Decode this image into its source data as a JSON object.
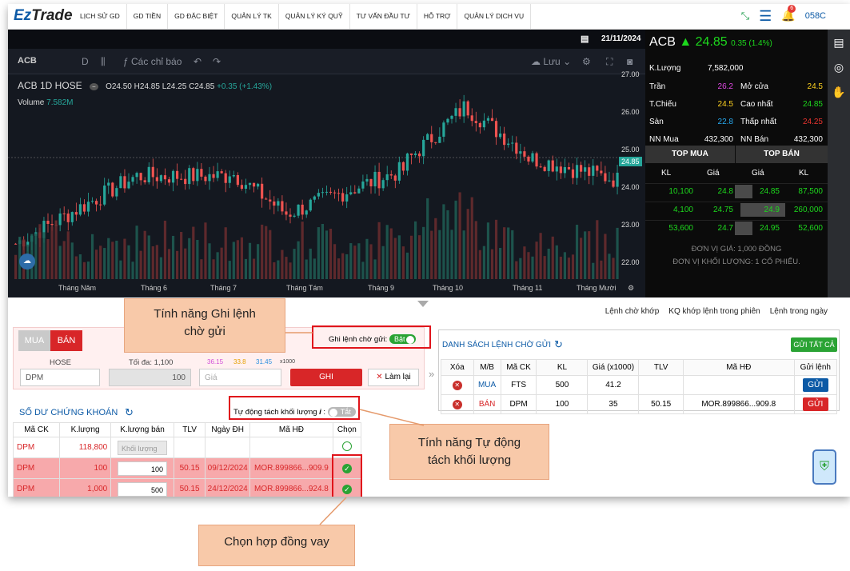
{
  "nav": {
    "logo_ez": "Ez",
    "logo_trade": "Trade",
    "menu": [
      "LỊCH SỬ GD",
      "GD TIỀN",
      "GD ĐẶC BIỆT",
      "QUẢN LÝ TK",
      "QUẢN LÝ KÝ QUỸ",
      "TƯ VẤN ĐẦU TƯ",
      "HỖ TRỢ",
      "QUẢN LÝ DỊCH VỤ"
    ],
    "bell_count": "6",
    "account": "058C"
  },
  "chart": {
    "date": "21/11/2024",
    "symbol": "ACB",
    "interval": "D",
    "indicators": "Các chỉ báo",
    "save": "Lưu",
    "legend_title": "ACB 1D HOSE",
    "o": "O24.50",
    "h": "H24.85",
    "l": "L24.25",
    "c": "C24.85",
    "chg": "+0.35 (+1.43%)",
    "volume_label": "Volume",
    "volume_value": "7.582M",
    "price_tag": "24.85",
    "yticks": [
      "27.00",
      "26.00",
      "25.00",
      "24.00",
      "23.00",
      "22.00"
    ],
    "xticks": [
      "Tháng Năm",
      "Tháng 6",
      "Tháng 7",
      "Tháng Tám",
      "Tháng 9",
      "Tháng 10",
      "Tháng 11",
      "Tháng Mười"
    ]
  },
  "quote": {
    "symbol": "ACB",
    "price": "24.85",
    "change": "0.35 (1.4%)",
    "klabel": "K.Lượng",
    "kval": "7,582,000",
    "rows": [
      {
        "l1": "Trần",
        "v1": "26.2",
        "l2": "Mở cửa",
        "v2": "24.5"
      },
      {
        "l1": "T.Chiếu",
        "v1": "24.5",
        "l2": "Cao nhất",
        "v2": "24.85"
      },
      {
        "l1": "Sàn",
        "v1": "22.8",
        "l2": "Thấp nhất",
        "v2": "24.25"
      },
      {
        "l1": "NN Mua",
        "v1": "432,300",
        "l2": "NN Bán",
        "v2": "432,300"
      }
    ],
    "top_buy": "TOP MUA",
    "top_sell": "TOP BÁN",
    "cols": [
      "KL",
      "Giá",
      "Giá",
      "KL"
    ],
    "book": [
      [
        "10,100",
        "24.8",
        "24.85",
        "87,500"
      ],
      [
        "4,100",
        "24.75",
        "24.9",
        "260,000"
      ],
      [
        "53,600",
        "24.7",
        "24.95",
        "52,600"
      ]
    ],
    "unit1": "ĐƠN VỊ GIÁ: 1,000 ĐỒNG",
    "unit2": "ĐƠN VỊ KHỐI LƯỢNG: 1 CỔ PHIẾU."
  },
  "links": [
    "Lệnh chờ khớp",
    "KQ khớp lệnh trong phiên",
    "Lệnh trong ngày"
  ],
  "order": {
    "buy": "MUA",
    "sell": "BÁN",
    "exchange": "HOSE",
    "max": "Tối đa: 1,100",
    "p1": "36.15",
    "p2": "33.8",
    "p3": "31.45",
    "mult": "x1000",
    "symbol": "DPM",
    "qty": "100",
    "price_ph": "Giá",
    "ghi": "GHI",
    "reset": "Làm lại",
    "pending_label": "Ghi lệnh chờ gửi:",
    "pending_toggle": "Bật"
  },
  "pending": {
    "title": "DANH SÁCH LỆNH CHỜ GỬI",
    "send_all": "GỬI TẤT CẢ",
    "headers": [
      "Xóa",
      "M/B",
      "Mã CK",
      "KL",
      "Giá (x1000)",
      "TLV",
      "Mã HĐ",
      "Gửi lệnh"
    ],
    "rows": [
      {
        "side": "MUA",
        "sym": "FTS",
        "kl": "500",
        "price": "41.2",
        "tlv": "",
        "hd": "",
        "btn": "GỬI"
      },
      {
        "side": "BÁN",
        "sym": "DPM",
        "kl": "100",
        "price": "35",
        "tlv": "50.15",
        "hd": "MOR.899866...909.8",
        "btn": "GỬI"
      }
    ]
  },
  "holdings": {
    "title": "SỐ DƯ CHỨNG KHOÁN",
    "auto_label": "Tự động tách khối lượng",
    "auto_toggle": "Tắt",
    "headers": [
      "Mã CK",
      "K.lượng",
      "K.lượng bán",
      "TLV",
      "Ngày ĐH",
      "Mã HĐ",
      "Chọn"
    ],
    "rows": [
      {
        "sym": "DPM",
        "kl": "118,800",
        "sell": "Khối lượng",
        "tlv": "",
        "date": "",
        "hd": ""
      },
      {
        "sym": "DPM",
        "kl": "100",
        "sell": "100",
        "tlv": "50.15",
        "date": "09/12/2024",
        "hd": "MOR.899866...909.9"
      },
      {
        "sym": "DPM",
        "kl": "1,000",
        "sell": "500",
        "tlv": "50.15",
        "date": "24/12/2024",
        "hd": "MOR.899866...924.8"
      }
    ]
  },
  "callouts": {
    "c1": "Tính năng Ghi lệnh chờ gửi",
    "c2": "Tính năng Tự động tách khối lượng",
    "c3": "Chọn hợp đồng vay"
  },
  "colors": {
    "up": "#26a69a",
    "down": "#ef5350",
    "brand": "#0c5aa6"
  }
}
